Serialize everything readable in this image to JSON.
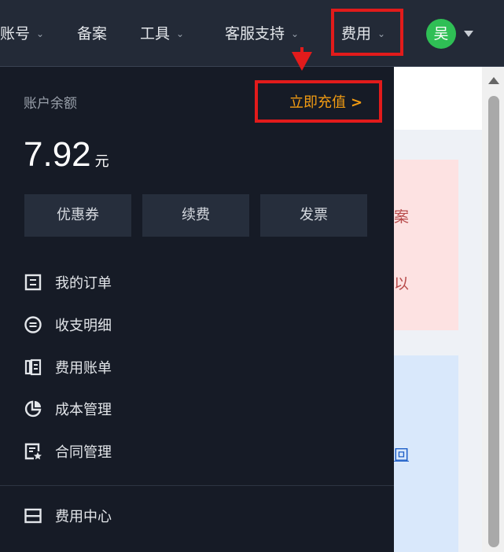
{
  "nav": {
    "account": "账号",
    "beian": "备案",
    "tools": "工具",
    "support": "客服支持",
    "fees": "费用",
    "avatar_char": "吴"
  },
  "panel": {
    "balance_label": "账户余额",
    "recharge_label": "立即充值",
    "recharge_arrow": ">",
    "balance_amount": "7.92",
    "balance_unit": "元",
    "buttons": [
      "优惠券",
      "续费",
      "发票"
    ],
    "menu": [
      {
        "label": "我的订单",
        "icon": "order-list-icon"
      },
      {
        "label": "收支明细",
        "icon": "income-expense-icon"
      },
      {
        "label": "费用账单",
        "icon": "bill-icon"
      },
      {
        "label": "成本管理",
        "icon": "cost-pie-icon"
      },
      {
        "label": "合同管理",
        "icon": "contract-icon"
      }
    ],
    "footer_item": {
      "label": "费用中心",
      "icon": "fee-center-icon"
    }
  },
  "background": {
    "pink_text_1": "案",
    "pink_text_2": "以",
    "blue_link": "回"
  },
  "colors": {
    "nav_bg": "#232a37",
    "panel_bg": "#161b26",
    "accent": "#f39c12",
    "highlight": "#e21b1b",
    "avatar": "#2fbf55"
  }
}
